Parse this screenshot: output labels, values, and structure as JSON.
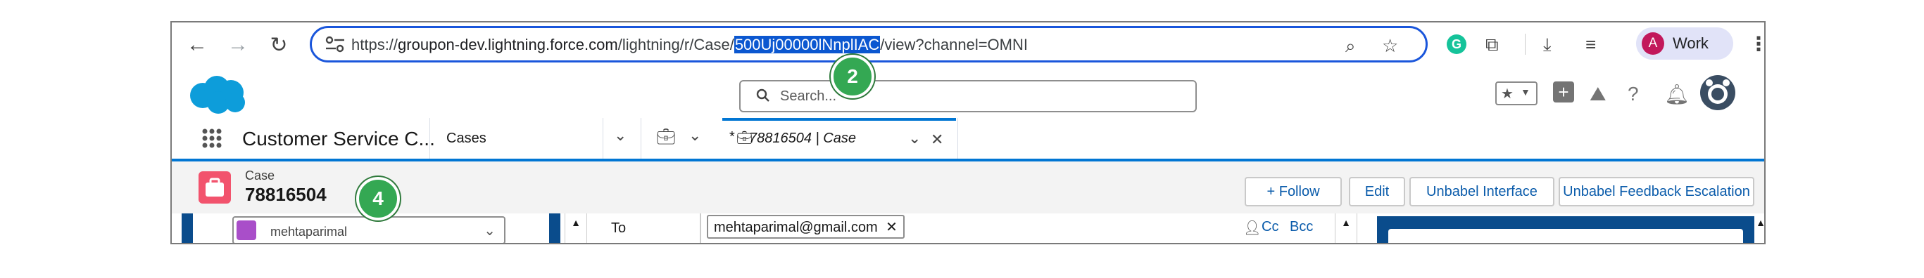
{
  "browser": {
    "url_prefix": "https://",
    "url_host": "groupon-dev.lightning.force.com",
    "url_path_before": "/lightning/r/Case/",
    "url_selected": "500Uj00000lNnplIAC",
    "url_path_after": "/view?channel=OMNI",
    "profile_label": "Work",
    "profile_initial": "A",
    "badge_url_number": "2"
  },
  "salesforce": {
    "search_placeholder": "Search...",
    "app_name": "Customer Service C...",
    "nav_tab_label": "Cases",
    "case_tab_label": "78816504 | Case",
    "case_tab_unsaved_marker": "*",
    "object_label": "Case",
    "case_number": "78816504",
    "badge_case_number": "4",
    "actions": [
      "+ Follow",
      "Edit",
      "Unbabel Interface",
      "Unbabel Feedback Escalation"
    ],
    "email": {
      "left_truncated": "mehtaparimal",
      "to_label": "To",
      "to_recipient": "mehtaparimal@gmail.com",
      "cc_label": "Cc",
      "bcc_label": "Bcc"
    }
  },
  "colors": {
    "chrome_selection": "#0b57d0",
    "salesforce_brand": "#0176d3",
    "case_icon": "#f2536d",
    "badge_green": "#34a853"
  }
}
